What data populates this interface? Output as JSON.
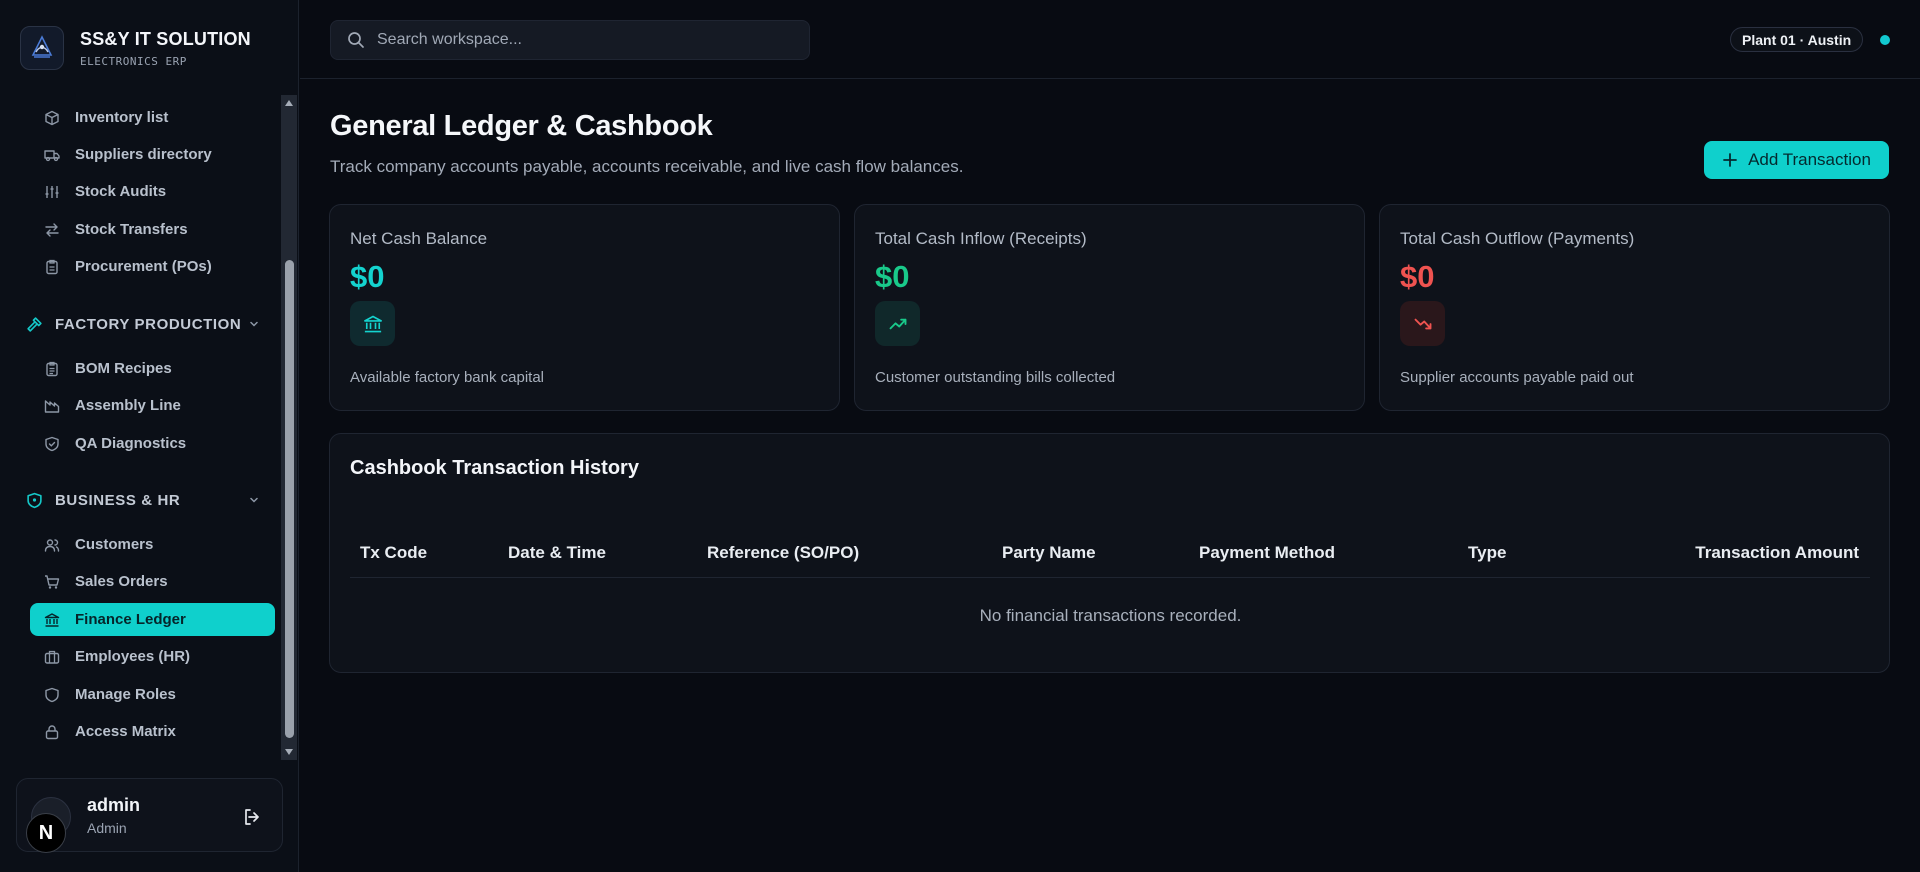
{
  "brand": {
    "title": "SS&Y IT SOLUTION",
    "subtitle": "ELECTRONICS ERP"
  },
  "sidebar": {
    "top_items": [
      {
        "label": "Inventory list",
        "icon": "boxes-icon"
      },
      {
        "label": "Suppliers directory",
        "icon": "truck-icon"
      },
      {
        "label": "Stock Audits",
        "icon": "sliders-icon"
      },
      {
        "label": "Stock Transfers",
        "icon": "arrows-swap-icon"
      },
      {
        "label": "Procurement (POs)",
        "icon": "clipboard-icon"
      }
    ],
    "factory_section": {
      "label": "FACTORY PRODUCTION",
      "icon": "hammer-icon",
      "items": [
        {
          "label": "BOM Recipes",
          "icon": "clipboard-list-icon"
        },
        {
          "label": "Assembly Line",
          "icon": "factory-icon"
        },
        {
          "label": "QA Diagnostics",
          "icon": "shield-check-icon"
        }
      ]
    },
    "business_section": {
      "label": "BUSINESS & HR",
      "icon": "shield-icon",
      "items": [
        {
          "label": "Customers",
          "icon": "users-icon"
        },
        {
          "label": "Sales Orders",
          "icon": "cart-icon"
        },
        {
          "label": "Finance Ledger",
          "icon": "bank-icon",
          "active": true
        },
        {
          "label": "Employees (HR)",
          "icon": "briefcase-icon"
        },
        {
          "label": "Manage Roles",
          "icon": "shield-icon"
        },
        {
          "label": "Access Matrix",
          "icon": "lock-icon"
        }
      ]
    }
  },
  "user": {
    "name": "admin",
    "role": "Admin",
    "badge": "N"
  },
  "topbar": {
    "search_placeholder": "Search workspace...",
    "plant": "Plant 01 · Austin"
  },
  "page": {
    "title": "General Ledger & Cashbook",
    "subtitle": "Track company accounts payable, accounts receivable, and live cash flow balances.",
    "add_button": "Add Transaction"
  },
  "stats": [
    {
      "label": "Net Cash Balance",
      "value": "$0",
      "note": "Available factory bank capital",
      "icon": "bank-icon",
      "color": "#14d3cf"
    },
    {
      "label": "Total Cash Inflow (Receipts)",
      "value": "$0",
      "note": "Customer outstanding bills collected",
      "icon": "trend-up-icon",
      "color": "#19c98a"
    },
    {
      "label": "Total Cash Outflow (Payments)",
      "value": "$0",
      "note": "Supplier accounts payable paid out",
      "icon": "trend-down-icon",
      "color": "#ef5350"
    }
  ],
  "history": {
    "title": "Cashbook Transaction History",
    "columns": [
      "Tx Code",
      "Date & Time",
      "Reference (SO/PO)",
      "Party Name",
      "Payment Method",
      "Type",
      "Transaction Amount"
    ],
    "empty_message": "No financial transactions recorded."
  }
}
